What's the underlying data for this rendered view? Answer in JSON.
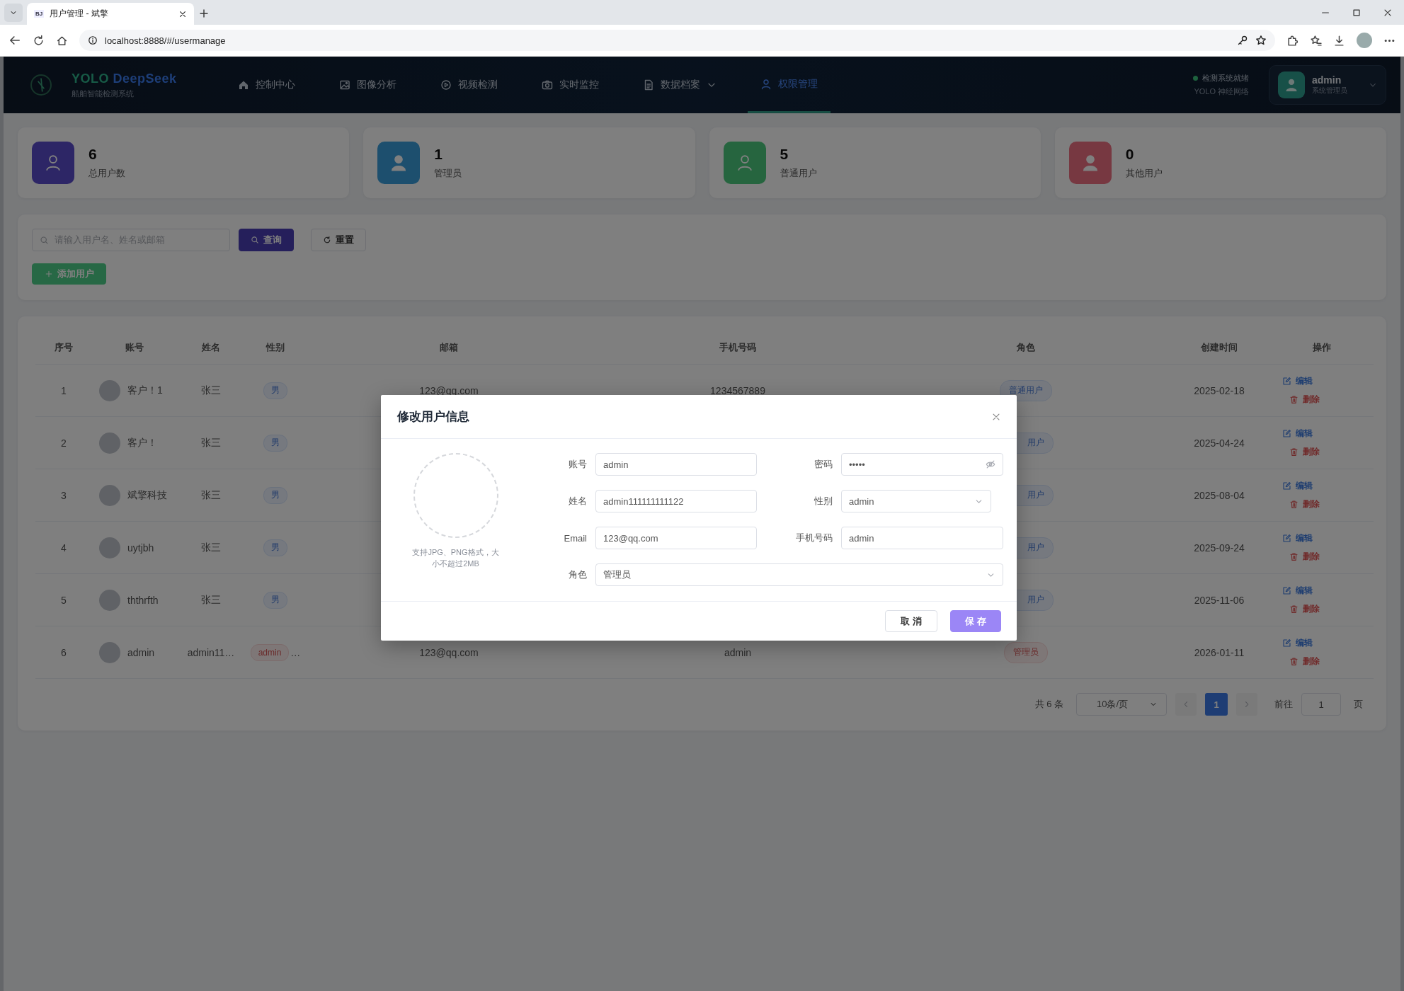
{
  "browser": {
    "favicon_text": "BJ",
    "tab_title": "用户管理 - 斌擎",
    "url": "localhost:8888/#/usermanage"
  },
  "header": {
    "brand_words": [
      "YOLO",
      "DeepSeek"
    ],
    "subtitle": "船舶智能检测系统",
    "nav": [
      {
        "label": "控制中心",
        "selected": false,
        "has_menu": false
      },
      {
        "label": "图像分析",
        "selected": false,
        "has_menu": false
      },
      {
        "label": "视频检测",
        "selected": false,
        "has_menu": false
      },
      {
        "label": "实时监控",
        "selected": false,
        "has_menu": false
      },
      {
        "label": "数据档案",
        "selected": false,
        "has_menu": true
      },
      {
        "label": "权限管理",
        "selected": true,
        "has_menu": false
      }
    ],
    "status": {
      "text": "检测系统就绪",
      "subtext": "YOLO 神经网络",
      "online": true
    },
    "user": {
      "name": "admin",
      "role": "系统管理员"
    }
  },
  "stats": [
    {
      "value": "6",
      "label": "总用户数"
    },
    {
      "value": "1",
      "label": "管理员"
    },
    {
      "value": "5",
      "label": "普通用户"
    },
    {
      "value": "0",
      "label": "其他用户"
    }
  ],
  "search": {
    "placeholder": "请输入用户名、姓名或邮箱",
    "query_button": "查询",
    "reset_button": "重置",
    "add_button": "添加用户"
  },
  "table": {
    "columns": [
      "序号",
      "账号",
      "姓名",
      "性别",
      "邮箱",
      "手机号码",
      "角色",
      "创建时间",
      "操作"
    ],
    "rows": [
      {
        "index": "1",
        "account": "客户！1",
        "name": "张三",
        "gender": {
          "text": "男",
          "kind": "male"
        },
        "email": "123@qq.com",
        "phone": "1234567889",
        "role": {
          "text": "普通用户",
          "kind": "user",
          "cut": false
        },
        "created": "2025-02-18",
        "actions": [
          "编辑",
          "删除"
        ]
      },
      {
        "index": "2",
        "account": "客户！",
        "name": "张三",
        "gender": {
          "text": "男",
          "kind": "male"
        },
        "role": {
          "text": "用户",
          "kind": "user",
          "cut": true
        },
        "created": "2025-04-24",
        "actions": [
          "编辑",
          "删除"
        ]
      },
      {
        "index": "3",
        "account": "斌擎科技",
        "name": "张三",
        "gender": {
          "text": "男",
          "kind": "male"
        },
        "role": {
          "text": "用户",
          "kind": "user",
          "cut": true
        },
        "created": "2025-08-04",
        "actions": [
          "编辑",
          "删除"
        ]
      },
      {
        "index": "4",
        "account": "uytjbh",
        "name": "张三",
        "gender": {
          "text": "男",
          "kind": "male"
        },
        "role": {
          "text": "用户",
          "kind": "user",
          "cut": true
        },
        "created": "2025-09-24",
        "actions": [
          "编辑",
          "删除"
        ]
      },
      {
        "index": "5",
        "account": "ththrfth",
        "name": "张三",
        "gender": {
          "text": "男",
          "kind": "male"
        },
        "role": {
          "text": "用户",
          "kind": "user",
          "cut": true
        },
        "created": "2025-11-06",
        "actions": [
          "编辑",
          "删除"
        ]
      },
      {
        "index": "6",
        "account": "admin",
        "name": "admin11…",
        "gender": {
          "text": "admin",
          "kind": "other",
          "more": "…"
        },
        "email": "123@qq.com",
        "phone": "admin",
        "role": {
          "text": "管理员",
          "kind": "admin",
          "cut": false
        },
        "created": "2026-01-11",
        "actions": [
          "编辑",
          "删除"
        ]
      }
    ]
  },
  "pagination": {
    "total": "共 6 条",
    "page_size": "10条/页",
    "pages": [
      {
        "label": "1",
        "selected": true
      }
    ],
    "goto_label": "前往",
    "goto_value": "1",
    "page_suffix": "页"
  },
  "dialog": {
    "title": "修改用户信息",
    "upload_hint": "支持JPG、PNG格式，大小不超过2MB",
    "fields": [
      {
        "label": "账号",
        "value": "admin",
        "kind": "text",
        "wide": false
      },
      {
        "label": "密码",
        "value": "•••••",
        "kind": "password",
        "wide": false
      },
      {
        "label": "姓名",
        "value": "admin111111111122",
        "kind": "text",
        "wide": false
      },
      {
        "label": "性别",
        "value": "admin",
        "kind": "select",
        "wide": false
      },
      {
        "label": "Email",
        "value": "123@qq.com",
        "kind": "text",
        "wide": false
      },
      {
        "label": "手机号码",
        "value": "admin",
        "kind": "text",
        "wide": false
      },
      {
        "label": "角色",
        "value": "管理员",
        "kind": "select",
        "wide": true
      }
    ],
    "cancel_button": "取 消",
    "save_button": "保 存"
  }
}
